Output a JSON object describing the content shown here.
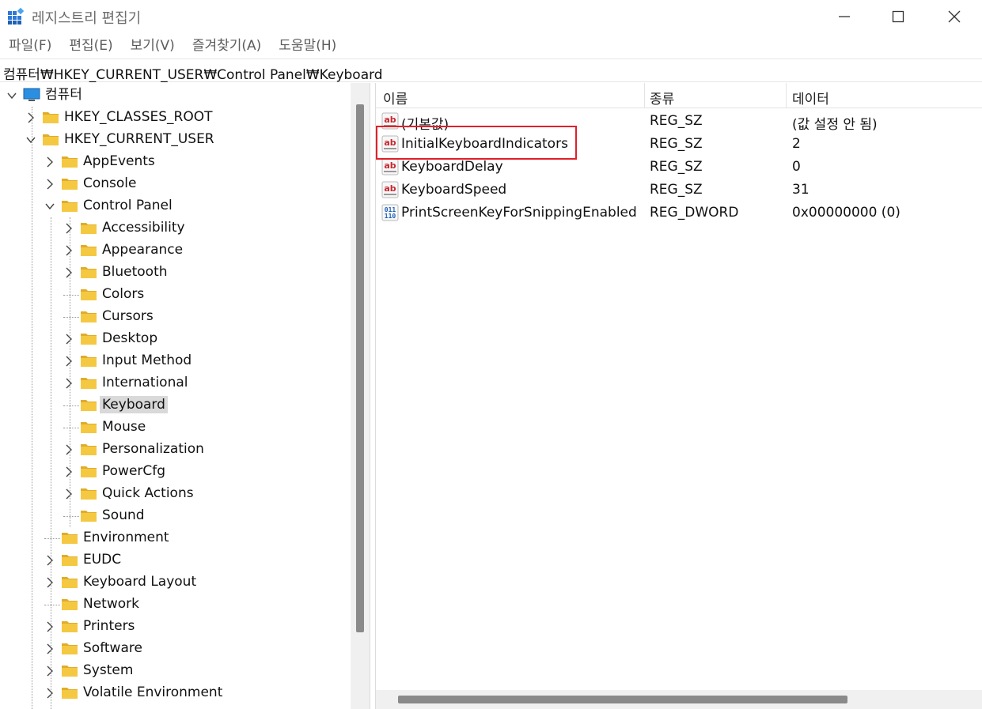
{
  "window": {
    "title": "레지스트리 편집기"
  },
  "menu": [
    "파일(F)",
    "편집(E)",
    "보기(V)",
    "즐겨찾기(A)",
    "도움말(H)"
  ],
  "address": "컴퓨터₩HKEY_CURRENT_USER₩Control Panel₩Keyboard",
  "tree": {
    "root": "컴퓨터",
    "hkcr": "HKEY_CLASSES_ROOT",
    "hkcu": "HKEY_CURRENT_USER",
    "level1": [
      "AppEvents",
      "Console",
      "Control Panel"
    ],
    "control_panel_children": [
      "Accessibility",
      "Appearance",
      "Bluetooth",
      "Colors",
      "Cursors",
      "Desktop",
      "Input Method",
      "International",
      "Keyboard",
      "Mouse",
      "Personalization",
      "PowerCfg",
      "Quick Actions",
      "Sound"
    ],
    "level1_after": [
      "Environment",
      "EUDC",
      "Keyboard Layout",
      "Network",
      "Printers",
      "Software",
      "System",
      "Volatile Environment"
    ],
    "selected": "Keyboard"
  },
  "list": {
    "columns": [
      "이름",
      "종류",
      "데이터"
    ],
    "rows": [
      {
        "name": "(기본값)",
        "type": "REG_SZ",
        "data": "(값 설정 안 됨)",
        "icon": "string-value-icon"
      },
      {
        "name": "InitialKeyboardIndicators",
        "type": "REG_SZ",
        "data": "2",
        "icon": "string-value-icon"
      },
      {
        "name": "KeyboardDelay",
        "type": "REG_SZ",
        "data": "0",
        "icon": "string-value-icon"
      },
      {
        "name": "KeyboardSpeed",
        "type": "REG_SZ",
        "data": "31",
        "icon": "string-value-icon"
      },
      {
        "name": "PrintScreenKeyForSnippingEnabled",
        "type": "REG_DWORD",
        "data": "0x00000000 (0)",
        "icon": "dword-value-icon"
      }
    ],
    "highlighted_row": "InitialKeyboardIndicators"
  },
  "colors": {
    "folder": "#f5c842",
    "highlight": "#e0202a",
    "selection": "#d9d9d9"
  }
}
